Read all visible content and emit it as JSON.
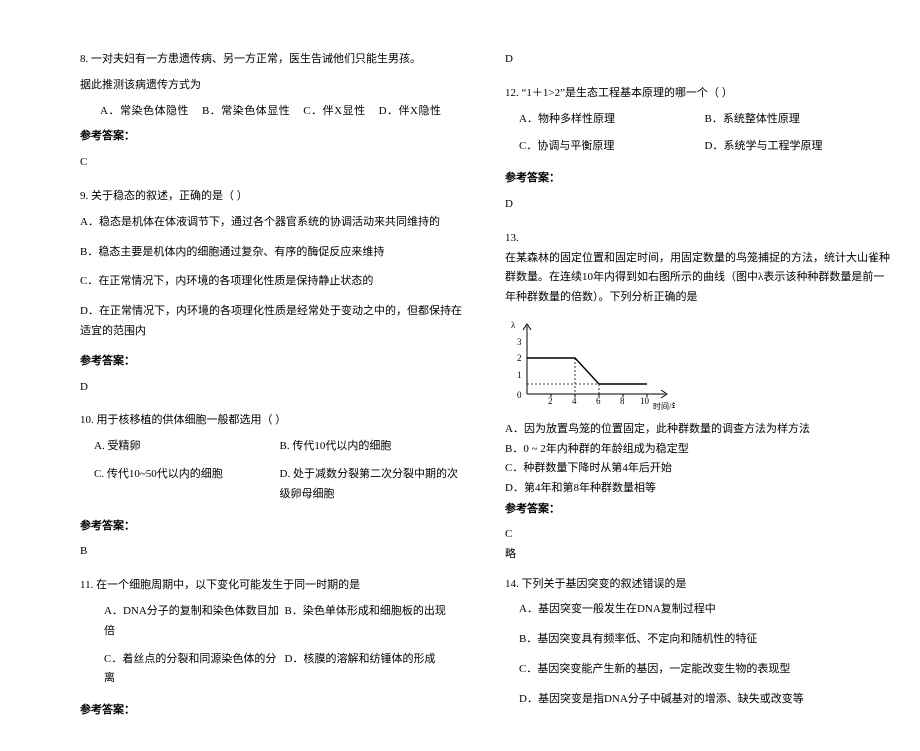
{
  "left": {
    "q8": {
      "num": "8.",
      "text1": "一对夫妇有一方患遗传病、另一方正常，医生告诫他们只能生男孩。",
      "text2": "据此推测该病遗传方式为",
      "optA": "A．常染色体隐性",
      "optB": "B．常染色体显性",
      "optC": "C．伴X显性",
      "optD": "D．伴X隐性",
      "ansLabel": "参考答案：",
      "ans": "C"
    },
    "q9": {
      "num": "9.",
      "text": "关于稳态的叙述，正确的是（  ）",
      "optA": "A．稳态是机体在体液调节下，通过各个器官系统的协调活动来共同维持的",
      "optB": "B．稳态主要是机体内的细胞通过复杂、有序的酶促反应来维持",
      "optC": "C．在正常情况下，内环境的各项理化性质是保持静止状态的",
      "optD": "D．在正常情况下，内环境的各项理化性质是经常处于变动之中的，但都保持在适宜的范围内",
      "ansLabel": "参考答案：",
      "ans": "D"
    },
    "q10": {
      "num": "10.",
      "text": "用于核移植的供体细胞一般都选用（  ）",
      "optA": "A. 受精卵",
      "optB": "B. 传代10代以内的细胞",
      "optC": "C. 传代10~50代以内的细胞",
      "optD": "D. 处于减数分裂第二次分裂中期的次级卵母细胞",
      "ansLabel": "参考答案：",
      "ans": "B"
    },
    "q11": {
      "num": "11.",
      "text": "在一个细胞周期中，以下变化可能发生于同一时期的是",
      "optA": "A．DNA分子的复制和染色体数目加倍",
      "optB": "B．染色单体形成和细胞板的出现",
      "optC": "C．着丝点的分裂和同源染色体的分离",
      "optD": "D．核膜的溶解和纺锤体的形成",
      "ansLabel": "参考答案："
    }
  },
  "right": {
    "q11ans": "D",
    "q12": {
      "num": "12.",
      "text": "“1＋1>2”是生态工程基本原理的哪一个（        ）",
      "optA": "A．物种多样性原理",
      "optB": "B．系统整体性原理",
      "optC": "C．协调与平衡原理",
      "optD": "D．系统学与工程学原理",
      "ansLabel": "参考答案：",
      "ans": "D"
    },
    "q13": {
      "num": "13.",
      "text": "在某森林的固定位置和固定时间，用固定数量的鸟笼捕捉的方法，统计大山雀种群数量。在连续10年内得到如右图所示的曲线（图中λ表示该种种群数量是前一年种群数量的倍数）。下列分析正确的是",
      "optA": "A．因为放置鸟笼的位置固定，此种群数量的调查方法为样方法",
      "optB": "B．0 ~ 2年内种群的年龄组成为稳定型",
      "optC": "C．种群数量下降时从第4年后开始",
      "optD": "D．第4年和第8年种群数量相等",
      "ansLabel": "参考答案：",
      "ans": "C",
      "note": "略"
    },
    "q14": {
      "num": "14.",
      "text": "下列关于基因突变的叙述错误的是",
      "optA": "A．基因突变一般发生在DNA复制过程中",
      "optB": "B．基因突变具有频率低、不定向和随机性的特征",
      "optC": "C．基因突变能产生新的基因，一定能改变生物的表现型",
      "optD": "D．基因突变是指DNA分子中碱基对的增添、缺失或改变等"
    }
  },
  "chart_data": {
    "type": "line",
    "x": [
      0,
      2,
      4,
      6,
      8,
      10
    ],
    "y": [
      2,
      2,
      2,
      0.5,
      0.5,
      0.5
    ],
    "xlabel": "时间/年",
    "ylabel": "λ",
    "xlim": [
      0,
      10
    ],
    "ylim": [
      0,
      3
    ],
    "xticks": [
      0,
      2,
      4,
      6,
      8,
      10
    ],
    "yticks": [
      0,
      1,
      2,
      3
    ],
    "dashed_segments": true
  }
}
